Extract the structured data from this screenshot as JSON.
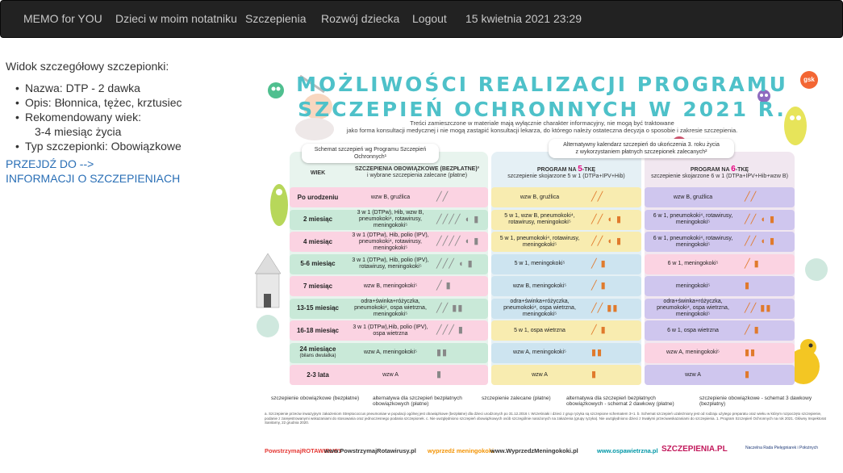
{
  "navbar": {
    "brand": "MEMO for YOU",
    "items": [
      "Dzieci w moim notatniku",
      "Szczepienia",
      "Rozwój dziecka",
      "Logout",
      "15 kwietnia 2021 23:29"
    ]
  },
  "details": {
    "heading": "Widok szczegółowy szczepionki:",
    "name": "Nazwa: DTP - 2 dawka",
    "description": "Opis: Błonnica, tężec, krztusiec",
    "age_label": "Rekomendowany wiek:",
    "age_value": "3-4 miesiąc życia",
    "type": "Typ szczepionki: Obowiązkowe",
    "link_line1": "PRZEJDŹ DO -->",
    "link_line2": "INFORMACJI O SZCZEPIENIACH"
  },
  "poster": {
    "title_line1": "MOŻLIWOŚCI REALIZACJI PROGRAMU",
    "title_line2": "SZCZEPIEŃ OCHRONNYCH W 2021 R.",
    "intro_line1": "Treści zamieszczone w materiale mają wyłącznie charakter informacyjny, nie mogą być traktowane",
    "intro_line2": "jako forma konsultacji medycznej i nie mogą zastąpić konsultacji lekarza, do którego należy ostateczna decyzja o sposobie i zakresie szczepienia.",
    "logo": "gsk",
    "section1": "Schemat szczepień wg Programu Szczepień Ochronnych¹",
    "section2_line1": "Alternatywny kalendarz szczepień do ukończenia 3. roku życia",
    "section2_line2": "z wykorzystaniem płatnych szczepionek zalecanych²",
    "col_wiek": "WIEK",
    "col1_line1": "SZCZEPIENIA OBOWIĄZKOWE (BEZPŁATNE)³",
    "col1_line2": "i wybrane szczepienia zalecane (płatne)",
    "col2_pre": "PROGRAM NA ",
    "col2_num": "5",
    "col2_post": "-TKĘ",
    "col2_sub": "szczepienie skojarzone 5 w 1 (DTPa+IPV+Hib)",
    "col3_pre": "PROGRAM NA ",
    "col3_num": "6",
    "col3_post": "-TKĘ",
    "col3_sub": "szczepienie skojarzone 6 w 1 (DTPa+IPV+Hib+wzw B)",
    "rows": [
      {
        "age": "Po urodzeniu",
        "age_sub": "",
        "c1": "wzw B, gruźlica",
        "c2": "wzw B, gruźlica",
        "c3": "wzw B, gruźlica",
        "icons1": "╱╱",
        "icons2": "╱╱",
        "icons3": "╱╱"
      },
      {
        "age": "2 miesiąc",
        "age_sub": "",
        "c1": "3 w 1 (DTPw), Hib, wzw B, pneumokoki⁴, rotawirusy, meningokoki⁵",
        "c2": "5 w 1, wzw B, pneumokoki⁴, rotawirusy, meningokoki⁵",
        "c3": "6 w 1, pneumokoki⁴, rotawirusy, meningokoki⁵",
        "icons1": "╱╱╱╱ ◖ ▮",
        "icons2": "╱╱ ◖ ▮",
        "icons3": "╱╱ ◖ ▮"
      },
      {
        "age": "4 miesiąc",
        "age_sub": "",
        "c1": "3 w 1 (DTPw), Hib, polio (IPV), pneumokoki⁴, rotawirusy, meningokoki⁵",
        "c2": "5 w 1, pneumokoki⁴, rotawirusy, meningokoki⁵",
        "c3": "6 w 1, pneumokoki⁴, rotawirusy, meningokoki⁵",
        "icons1": "╱╱╱╱ ◖ ▮",
        "icons2": "╱╱ ◖ ▮",
        "icons3": "╱╱ ◖ ▮"
      },
      {
        "age": "5-6 miesiąc",
        "age_sub": "",
        "c1": "3 w 1 (DTPw), Hib, polio (IPV), rotawirusy, meningokoki⁵",
        "c2": "5 w 1, meningokoki⁵",
        "c3": "6 w 1, meningokoki⁵",
        "icons1": "╱╱╱ ◖ ▮",
        "icons2": "╱ ▮",
        "icons3": "╱ ▮"
      },
      {
        "age": "7 miesiąc",
        "age_sub": "",
        "c1": "wzw B, meningokoki⁵",
        "c2": "wzw B, meningokoki⁵",
        "c3": "meningokoki⁵",
        "icons1": "╱ ▮",
        "icons2": "╱ ▮",
        "icons3": "▮"
      },
      {
        "age": "13-15 miesiąc",
        "age_sub": "",
        "c1": "odra+świnka+różyczka, pneumokoki⁴, ospa wietrzna, meningokoki⁵",
        "c2": "odra+świnka+różyczka, pneumokoki⁴, ospa wietrzna, meningokoki⁵",
        "c3": "odra+świnka+różyczka, pneumokoki⁴, ospa wietrzna, meningokoki⁵",
        "icons1": "╱╱ ▮▮",
        "icons2": "╱╱ ▮▮",
        "icons3": "╱╱ ▮▮"
      },
      {
        "age": "16-18 miesiąc",
        "age_sub": "",
        "c1": "3 w 1 (DTPw),Hib, polio (IPV), ospa wietrzna",
        "c2": "5 w 1, ospa wietrzna",
        "c3": "6 w 1, ospa wietrzna",
        "icons1": "╱╱╱ ▮",
        "icons2": "╱ ▮",
        "icons3": "╱ ▮"
      },
      {
        "age": "24 miesiące",
        "age_sub": "(bilans dwulatka)",
        "c1": "wzw A, meningokoki⁵",
        "c2": "wzw A, meningokoki⁵",
        "c3": "wzw A, meningokoki⁵",
        "icons1": "▮▮",
        "icons2": "▮▮",
        "icons3": "▮▮"
      },
      {
        "age": "2-3 lata",
        "age_sub": "",
        "c1": "wzw A",
        "c2": "wzw A",
        "c3": "wzw A",
        "icons1": "▮",
        "icons2": "▮",
        "icons3": "▮"
      }
    ],
    "legend": [
      "szczepienie obowiązkowe (bezpłatne)",
      "alternatywa dla szczepień bezpłatnych obowiązkowych (płatne)",
      "szczepienie zalecane (płatne)",
      "alternatywa dla szczepień bezpłatnych obowiązkowych - schemat 2 dawkowy (płatne)",
      "szczepienie obowiązkowe - schemat 3 dawkowy (bezpłatny)"
    ],
    "footnote": "a. Szczepienie przeciw inwazyjnym zakażeniom Streptococcus pneumoniae w populacji ogólnej jest obowiązkowe (bezpłatne) dla dzieci urodzonych po 31.12.2016 r. Wcześniaki i dzieci z grup ryzyka są szczepione schematem 3+1. b. Schemat szczepień uzależniony jest od rodzaju użytego preparatu oraz wieku w którym rozpoczęto szczepienie, podanie z zarejestrowanymi wskazaniami do stosowania oraz jednoczesnego podania szczepionek. c. Nie uwzględniono szczepień obowiązkowych osób szczególnie narażonych na zakażenia (grupy ryzyka). Nie uwzględniono dzieci z trwałymi przeciwwskazaniami do szczepienia. 1. Program Szczepień Ochronnych na rok 2021. Główny Inspektorat Sanitarny, 22 grudnia 2020.",
    "logos": [
      "PowstrzymajROTAWIRUSY",
      "www.PowstrzymajRotawirusy.pl",
      "wyprzedź meningokoki",
      "www.WyprzedzMeningokoki.pl",
      "www.ospawietrzna.pl",
      "SZCZEPIENIA.PL",
      "Naczelna Rada Pielęgniarek i Położnych"
    ]
  }
}
